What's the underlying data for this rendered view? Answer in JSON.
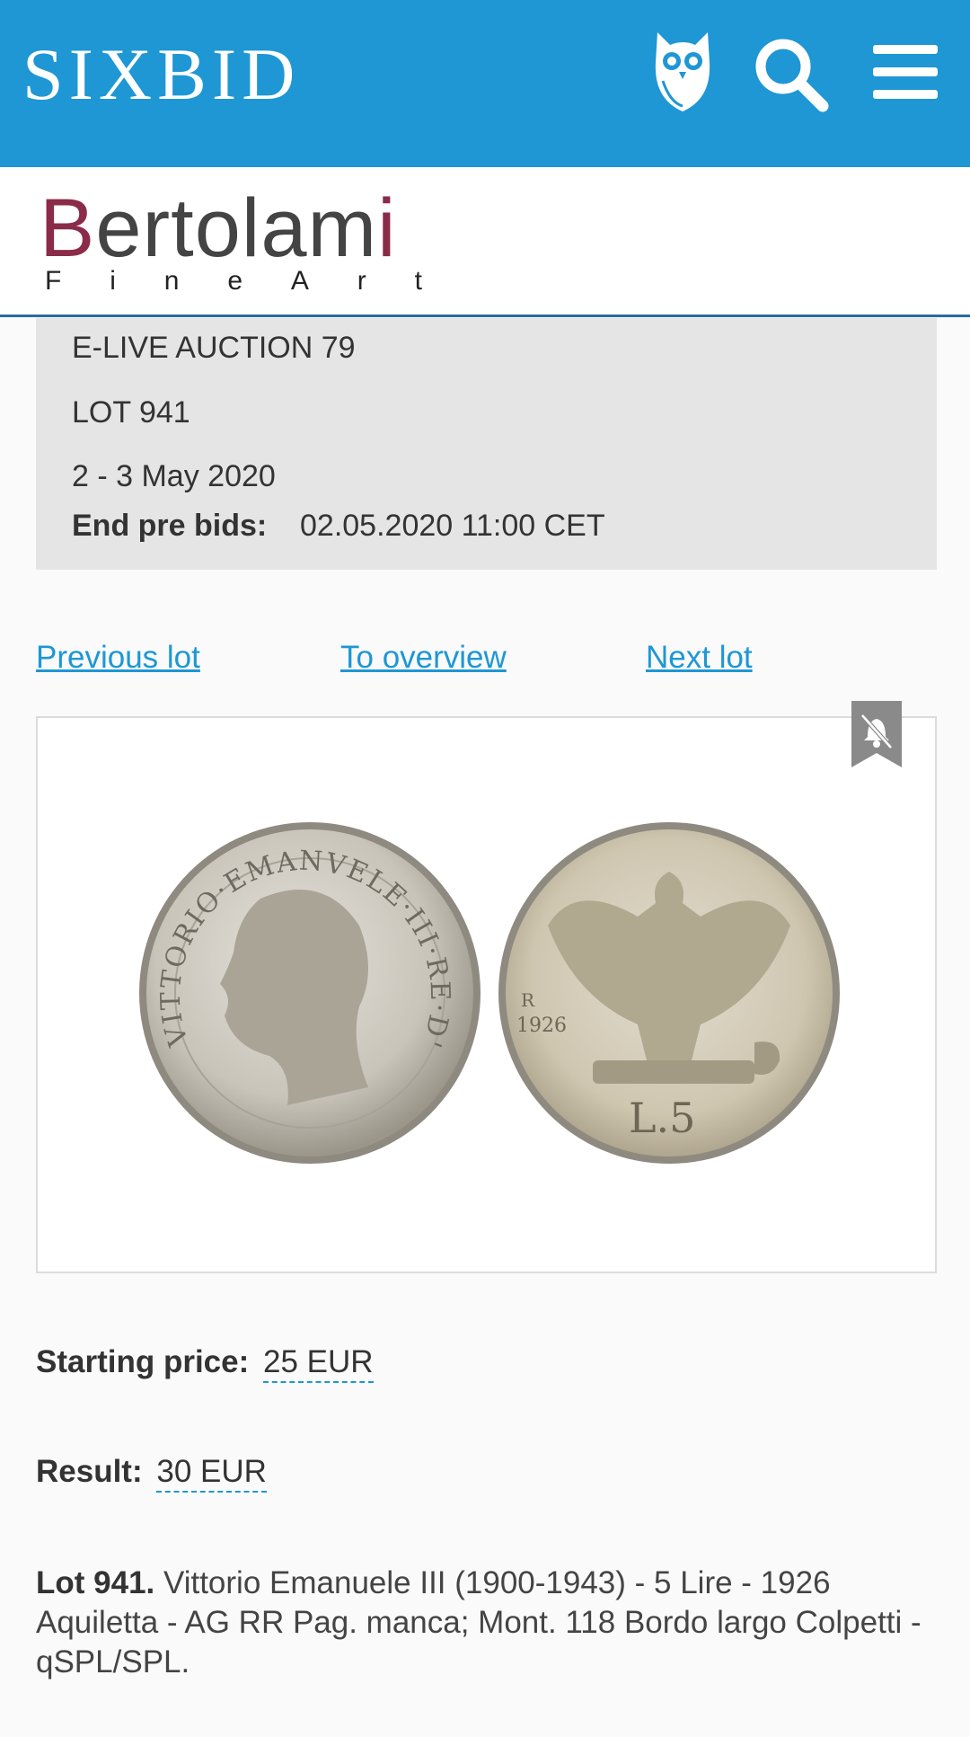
{
  "header": {
    "logo": "SIXBID",
    "icons": [
      "owl-icon",
      "search-icon",
      "menu-icon"
    ]
  },
  "brand": {
    "name_first": "B",
    "name_mid": "ertolam",
    "name_last": "i",
    "sub_letters": [
      "F",
      "i",
      "n",
      "e",
      "A",
      "r",
      "t"
    ]
  },
  "auction": {
    "title": "E-LIVE AUCTION 79",
    "lot": "LOT 941",
    "dates": "2 - 3 May 2020",
    "end_label": "End pre bids:",
    "end_value": "02.05.2020 11:00 CET"
  },
  "nav": {
    "previous": "Previous lot",
    "overview": "To overview",
    "next": "Next lot"
  },
  "prices": {
    "starting_label": "Starting price:",
    "starting_value": "25 EUR",
    "result_label": "Result:",
    "result_value": "30 EUR"
  },
  "description": {
    "lot_label": "Lot 941.",
    "text": " Vittorio Emanuele III (1900-1943) - 5 Lire - 1926 Aquiletta - AG RR Pag. manca; Mont. 118 Bordo largo Colpetti - qSPL/SPL."
  },
  "coin_image": {
    "obverse_legend": "VITTORIO·EMANVELE·III·RE·D'ITALIA",
    "reverse_denomination": "L.5",
    "reverse_year": "1926",
    "reverse_mint": "R"
  },
  "colors": {
    "header_blue": "#1e97d4",
    "brand_accent": "#8a2b4a",
    "info_bg": "#e5e5e5"
  }
}
